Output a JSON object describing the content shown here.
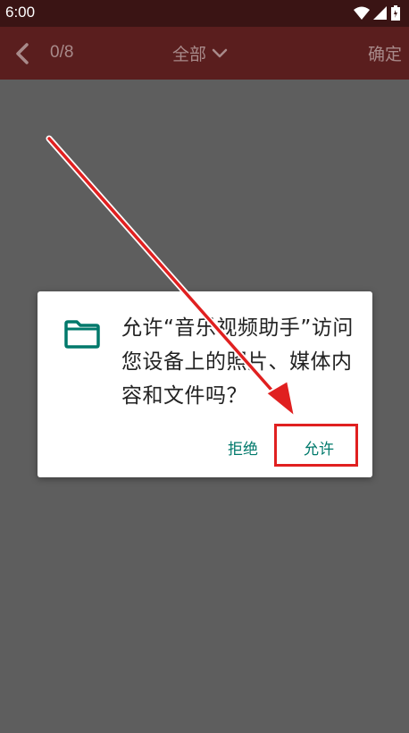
{
  "status_bar": {
    "time": "6:00"
  },
  "app_bar": {
    "counter": "0/8",
    "filter_label": "全部",
    "confirm_label": "确定"
  },
  "permission_dialog": {
    "message": "允许“音乐视频助手”访问您设备上的照片、媒体内容和文件吗？",
    "deny_label": "拒绝",
    "allow_label": "允许"
  },
  "colors": {
    "app_bar": "#5a1e1e",
    "overlay": "#5e5e5e",
    "accent": "#00796b",
    "annotation": "#e02020"
  },
  "icons": [
    "wifi-icon",
    "signal-icon",
    "battery-icon",
    "back-arrow-icon",
    "chevron-down-icon",
    "folder-icon"
  ]
}
